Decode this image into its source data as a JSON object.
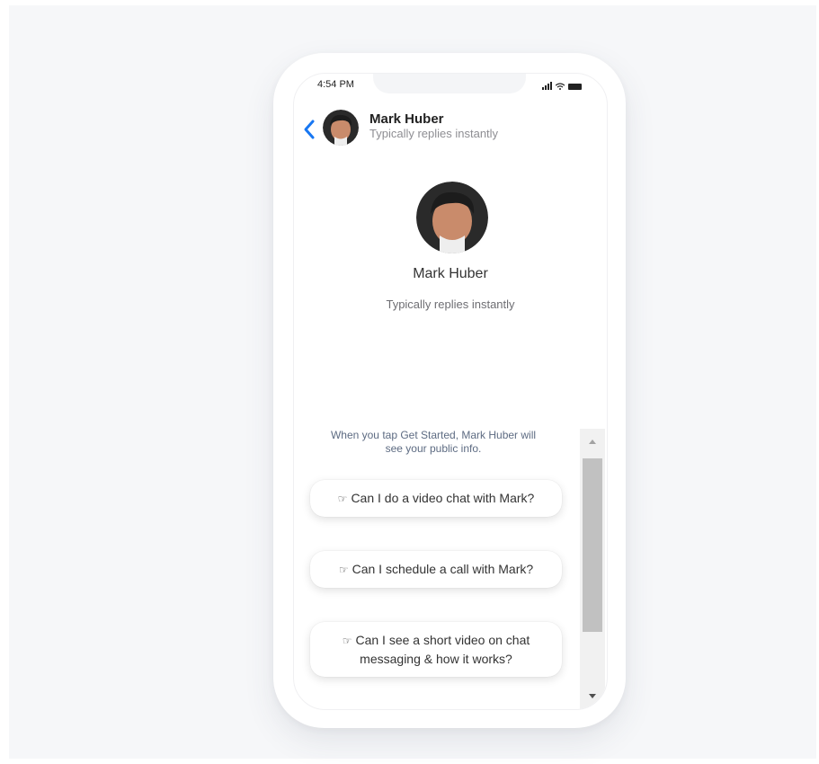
{
  "status_bar": {
    "time": "4:54 PM"
  },
  "header": {
    "name": "Mark Huber",
    "subtitle": "Typically replies instantly"
  },
  "profile": {
    "name": "Mark Huber",
    "subtitle": "Typically replies instantly"
  },
  "info_text": "When you tap Get Started, Mark Huber will see your public info.",
  "quick_replies": [
    {
      "label": "Can I do a video chat with Mark?"
    },
    {
      "label": "Can I schedule a call with Mark?"
    },
    {
      "label": "Can I see a short video on chat messaging & how it works?"
    }
  ],
  "colors": {
    "accent": "#1877f2",
    "secondary_text": "#8e8e93",
    "info_text": "#5d6b82"
  },
  "icons": {
    "back": "chevron-left-icon",
    "hand": "pointing-hand-icon",
    "signal": "signal-icon",
    "wifi": "wifi-icon",
    "battery": "battery-icon"
  }
}
